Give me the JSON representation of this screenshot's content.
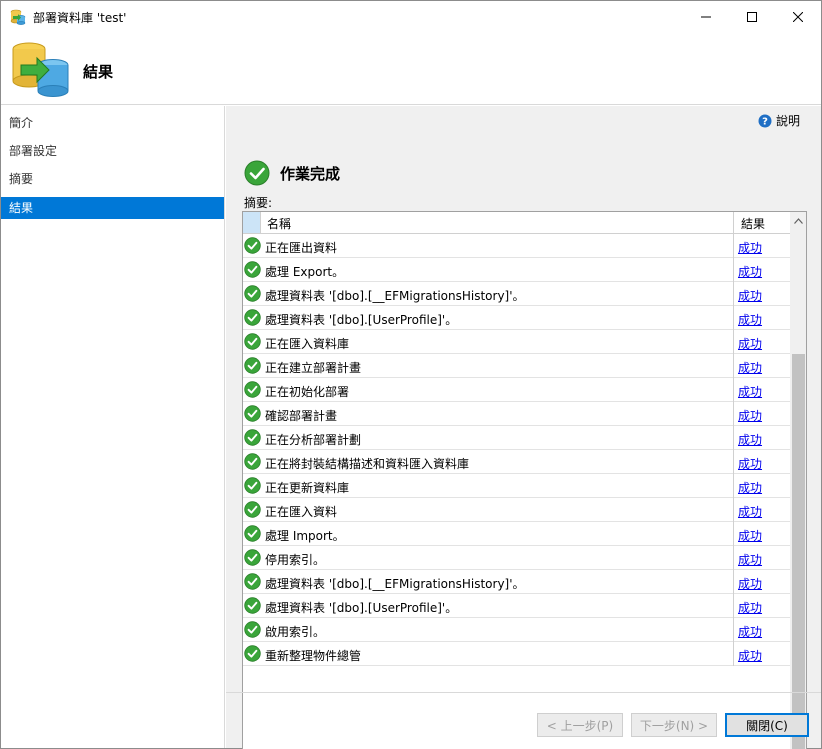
{
  "window": {
    "title": "部署資料庫 'test'"
  },
  "banner": {
    "title": "結果"
  },
  "sidebar": {
    "items": [
      {
        "label": "簡介"
      },
      {
        "label": "部署設定"
      },
      {
        "label": "摘要"
      },
      {
        "label": "結果",
        "active": true
      }
    ]
  },
  "main": {
    "help_label": "說明",
    "status_text": "作業完成",
    "summary_label": "摘要:",
    "grid": {
      "columns": {
        "name": "名稱",
        "result": "結果"
      },
      "rows": [
        {
          "name": "正在匯出資料",
          "result": "成功"
        },
        {
          "name": "處理 Export。",
          "result": "成功"
        },
        {
          "name": "處理資料表 '[dbo].[__EFMigrationsHistory]'。",
          "result": "成功"
        },
        {
          "name": "處理資料表 '[dbo].[UserProfile]'。",
          "result": "成功"
        },
        {
          "name": "正在匯入資料庫",
          "result": "成功"
        },
        {
          "name": "正在建立部署計畫",
          "result": "成功"
        },
        {
          "name": "正在初始化部署",
          "result": "成功"
        },
        {
          "name": "確認部署計畫",
          "result": "成功"
        },
        {
          "name": "正在分析部署計劃",
          "result": "成功"
        },
        {
          "name": "正在將封裝結構描述和資料匯入資料庫",
          "result": "成功"
        },
        {
          "name": "正在更新資料庫",
          "result": "成功"
        },
        {
          "name": "正在匯入資料",
          "result": "成功"
        },
        {
          "name": "處理 Import。",
          "result": "成功"
        },
        {
          "name": "停用索引。",
          "result": "成功"
        },
        {
          "name": "處理資料表 '[dbo].[__EFMigrationsHistory]'。",
          "result": "成功"
        },
        {
          "name": "處理資料表 '[dbo].[UserProfile]'。",
          "result": "成功"
        },
        {
          "name": "啟用索引。",
          "result": "成功"
        },
        {
          "name": "重新整理物件總管",
          "result": "成功"
        }
      ]
    }
  },
  "footer": {
    "back_label": "< 上一步(P)",
    "next_label": "下一步(N) >",
    "close_label": "關閉(C)"
  },
  "icons": {
    "success": "check-circle-icon",
    "help": "help-circle-icon",
    "banner": "database-deploy-icon"
  },
  "colors": {
    "accent": "#0078d7",
    "success_green": "#3aa53a",
    "link": "#0000ee"
  }
}
